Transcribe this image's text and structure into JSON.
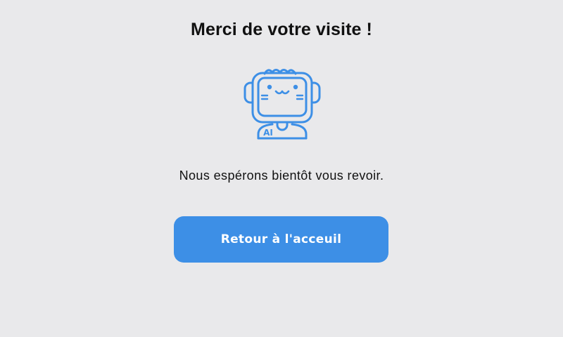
{
  "page": {
    "title": "Merci de votre visite !",
    "message": "Nous espérons bientôt vous revoir.",
    "button_label": "Retour à l'acceuil",
    "robot_badge": "AI"
  },
  "colors": {
    "background": "#e9e9eb",
    "accent": "#3d8fe6",
    "text": "#111111",
    "button_text": "#ffffff"
  },
  "icons": {
    "illustration": "robot-ai-icon"
  }
}
